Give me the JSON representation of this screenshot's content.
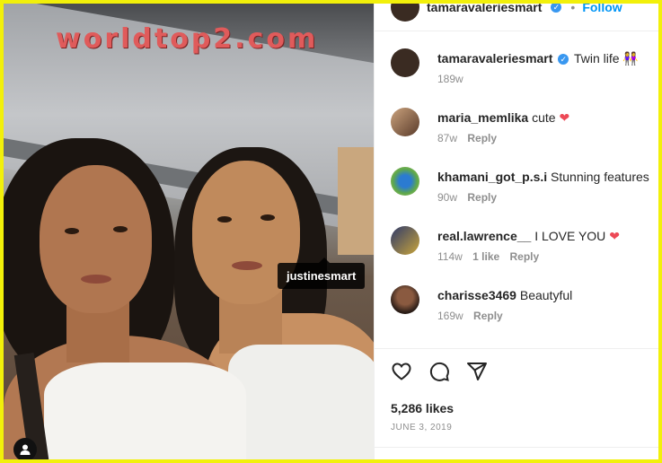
{
  "watermark": "worldtop2.com",
  "photo": {
    "tag_label": "justinesmart"
  },
  "post_header": {
    "username": "tamaravaleriesmart",
    "separator": "•",
    "follow_label": "Follow"
  },
  "comments": [
    {
      "username": "tamaravaleriesmart",
      "verified": true,
      "text": "Twin life 👭",
      "age": "189w",
      "likes": "",
      "reply": "",
      "avatar_color": "#3a2b22"
    },
    {
      "username": "maria_memlika",
      "verified": false,
      "text": "cute",
      "heart": "❤",
      "age": "87w",
      "likes": "",
      "reply": "Reply",
      "avatar_color": "#7b5b45"
    },
    {
      "username": "khamani_got_p.s.i",
      "verified": false,
      "text": "Stunning features",
      "age": "90w",
      "likes": "",
      "reply": "Reply",
      "avatar_color": "#4c8a3a"
    },
    {
      "username": "real.lawrence__",
      "verified": false,
      "text": "I LOVE YOU",
      "heart": "❤",
      "age": "114w",
      "likes": "1 like",
      "reply": "Reply",
      "avatar_color": "#2f3a6b"
    },
    {
      "username": "charisse3469",
      "verified": false,
      "text": "Beautyful",
      "age": "169w",
      "likes": "",
      "reply": "Reply",
      "avatar_color": "#3b2a22"
    }
  ],
  "engagement": {
    "likes": "5,286 likes",
    "date": "JUNE 3, 2019"
  },
  "colors": {
    "frame": "#f2f00a",
    "link": "#0095f6",
    "heart": "#ed4956",
    "meta": "#8e8e8e"
  }
}
